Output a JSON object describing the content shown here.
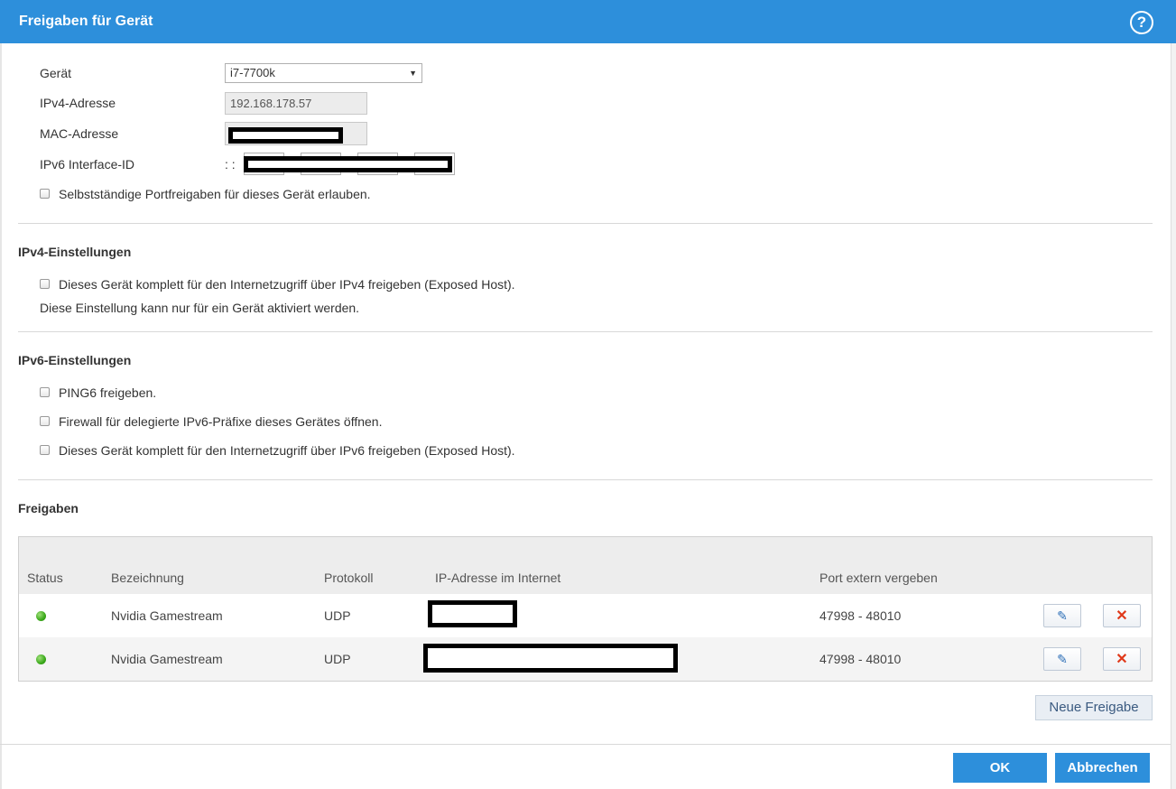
{
  "dialog": {
    "title": "Freigaben für Gerät",
    "help_icon": "?"
  },
  "device": {
    "geraet_label": "Gerät",
    "geraet_value": "i7-7700k",
    "ipv4_label": "IPv4-Adresse",
    "ipv4_value": "192.168.178.57",
    "mac_label": "MAC-Adresse",
    "ipv6_label": "IPv6 Interface-ID",
    "ipv6_prefix": ": :",
    "self_portfwd_label": "Selbstständige Portfreigaben für dieses Gerät erlauben."
  },
  "ipv4": {
    "heading": "IPv4-Einstellungen",
    "exposed_label": "Dieses Gerät komplett für den Internetzugriff über IPv4 freigeben (Exposed Host).",
    "note": "Diese Einstellung kann nur für ein Gerät aktiviert werden."
  },
  "ipv6": {
    "heading": "IPv6-Einstellungen",
    "ping6_label": "PING6 freigeben.",
    "firewall_label": "Firewall für delegierte IPv6-Präfixe dieses Gerätes öffnen.",
    "exposed_label": "Dieses Gerät komplett für den Internetzugriff über IPv6 freigeben (Exposed Host)."
  },
  "freigaben": {
    "heading": "Freigaben",
    "columns": [
      "Status",
      "Bezeichnung",
      "Protokoll",
      "IP-Adresse im Internet",
      "Port extern vergeben"
    ],
    "rows": [
      {
        "name": "Nvidia Gamestream",
        "protocol": "UDP",
        "port": "47998 - 48010"
      },
      {
        "name": "Nvidia Gamestream",
        "protocol": "UDP",
        "port": "47998 - 48010"
      }
    ],
    "new_button": "Neue Freigabe"
  },
  "footer": {
    "ok": "OK",
    "cancel": "Abbrechen"
  },
  "colors": {
    "accent": "#2d8fdb",
    "status_ok": "#3aa81a",
    "delete": "#e0391a"
  },
  "icons": {
    "help": "help-icon",
    "edit": "pencil-icon",
    "delete": "close-icon"
  }
}
